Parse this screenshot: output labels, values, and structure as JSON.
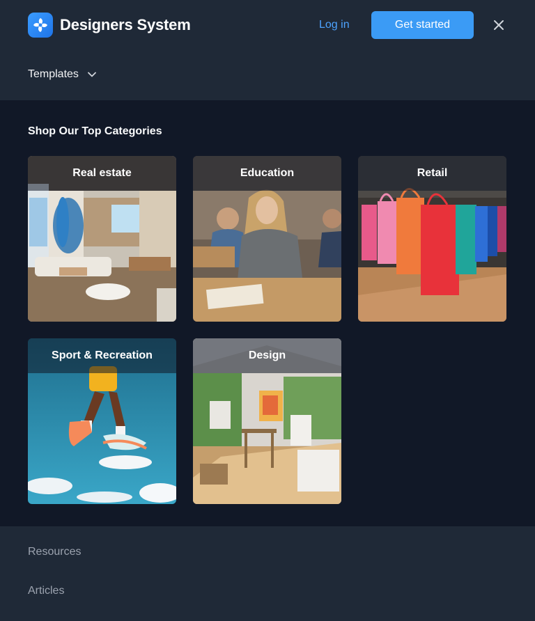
{
  "header": {
    "brand_name": "Designers System",
    "login_label": "Log in",
    "cta_label": "Get started",
    "templates_label": "Templates",
    "accent_color": "#3b9bf5"
  },
  "main": {
    "section_title": "Shop Our Top Categories",
    "categories": [
      {
        "label": "Real estate"
      },
      {
        "label": "Education"
      },
      {
        "label": "Retail"
      },
      {
        "label": "Sport & Recreation"
      },
      {
        "label": "Design"
      }
    ]
  },
  "footer": {
    "links": [
      {
        "label": "Resources"
      },
      {
        "label": "Articles"
      }
    ]
  },
  "icons": {
    "logo": "flower-logo-icon",
    "close": "close-icon",
    "templates_toggle": "chevron-down-icon"
  }
}
